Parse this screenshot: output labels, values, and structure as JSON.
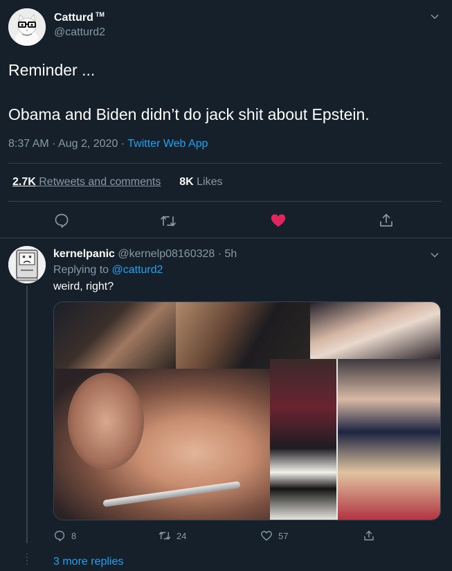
{
  "main_tweet": {
    "author_name": "Catturd",
    "author_badge": "TM",
    "author_handle": "@catturd2",
    "text_line1": "Reminder ...",
    "text_line2": "Obama and Biden didn’t do jack shit about Epstein.",
    "time": "8:37 AM",
    "date": "Aug 2, 2020",
    "separator": " · ",
    "source": "Twitter Web App",
    "retweets_count": "2.7K",
    "retweets_label": "Retweets and comments",
    "likes_count": "8K",
    "likes_label": "Likes",
    "actions": [
      "reply-icon",
      "retweet-icon",
      "like-icon-filled",
      "share-icon"
    ]
  },
  "reply": {
    "author_name": "kernelpanic",
    "author_handle": "@kernelp08160328",
    "time_ago": "5h",
    "separator": " · ",
    "replying_prefix": "Replying to ",
    "replying_to": "@catturd2",
    "text": "weird, right?",
    "reply_count": "8",
    "retweet_count": "24",
    "like_count": "57"
  },
  "more_replies": "3 more replies",
  "colors": {
    "background": "#15202b",
    "muted": "#8899a6",
    "link": "#1da1f2",
    "like": "#e0245e",
    "divider": "#38444d"
  }
}
